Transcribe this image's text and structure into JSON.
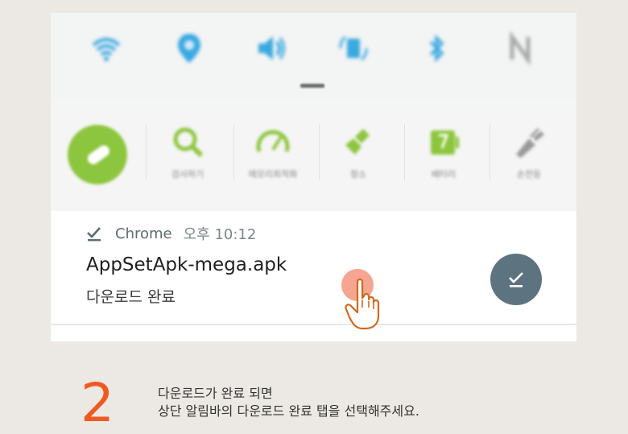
{
  "quick_settings": {
    "toggles": [
      "wifi-icon",
      "location-icon",
      "sound-icon",
      "screen-rotation-icon",
      "bluetooth-icon",
      "nfc-icon"
    ],
    "tiles": [
      {
        "icon": "power-saving-icon",
        "label": ""
      },
      {
        "icon": "search-icon",
        "label": "검사하기"
      },
      {
        "icon": "speed-icon",
        "label": "메모리최적화"
      },
      {
        "icon": "clean-icon",
        "label": "청소"
      },
      {
        "icon": "battery-icon",
        "label": "배터리"
      },
      {
        "icon": "flashlight-icon",
        "label": "손전등"
      }
    ],
    "accent_color": "#8cc63e"
  },
  "notification": {
    "app_name": "Chrome",
    "time": "오후 10:12",
    "file_name": "AppSetApk-mega.apk",
    "status": "다운로드 완료",
    "action_icon": "download-done-icon"
  },
  "instruction": {
    "step_number": "2",
    "line1": "다운로드가 완료 되면",
    "line2": "상단 알림바의 다운로드 완료 탭을 선택해주세요.",
    "step_color": "#f05a22"
  }
}
